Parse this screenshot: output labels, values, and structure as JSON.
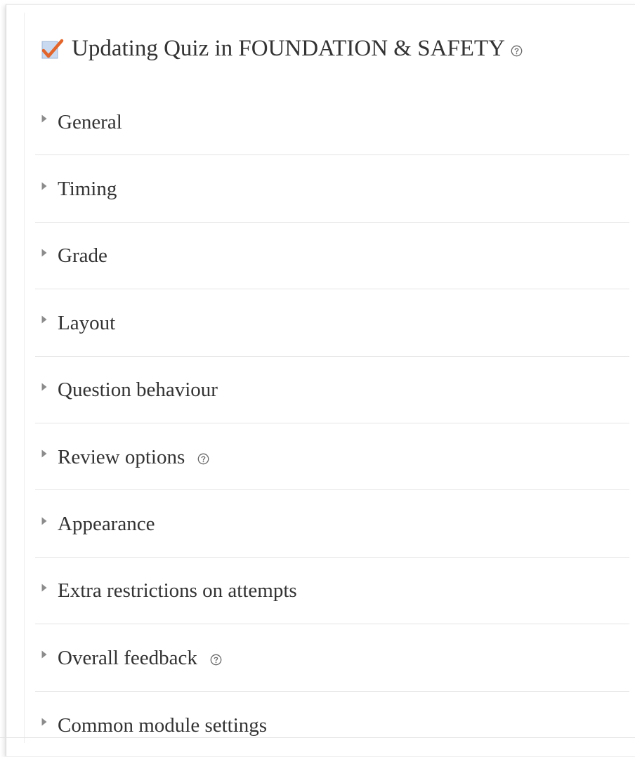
{
  "page": {
    "heading": "Updating Quiz in FOUNDATION & SAFETY",
    "heading_icon": "quiz-checkmark-icon",
    "heading_has_help": true
  },
  "sections": [
    {
      "label": "General",
      "help": false
    },
    {
      "label": "Timing",
      "help": false
    },
    {
      "label": "Grade",
      "help": false
    },
    {
      "label": "Layout",
      "help": false
    },
    {
      "label": "Question behaviour",
      "help": false
    },
    {
      "label": "Review options",
      "help": true
    },
    {
      "label": "Appearance",
      "help": false
    },
    {
      "label": "Extra restrictions on attempts",
      "help": false
    },
    {
      "label": "Overall feedback",
      "help": true
    },
    {
      "label": "Common module settings",
      "help": false
    }
  ],
  "colors": {
    "text": "#333333",
    "caret": "#8c8c8c",
    "check_orange": "#e2662b",
    "divider": "#e4e4e4"
  }
}
